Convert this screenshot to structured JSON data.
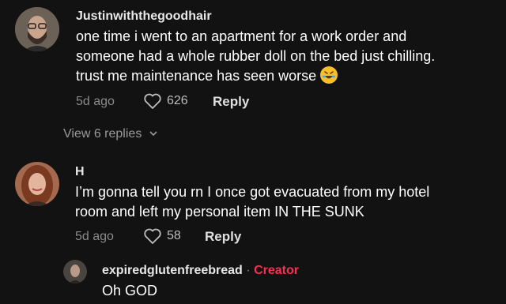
{
  "comments": [
    {
      "username": "Justinwiththegoodhair",
      "text": [
        "one time i went to an apartment for a work order and",
        "someone had a whole rubber doll on the bed just chilling.",
        "trust me maintenance has seen worse"
      ],
      "emoji": "rolling-on-floor-laughing",
      "time": "5d ago",
      "likes": "626",
      "reply_label": "Reply",
      "view_replies": "View 6 replies"
    },
    {
      "username": "H",
      "text": [
        "I’m gonna tell you rn I once got evacuated from my hotel",
        "room and left my personal item IN THE SUNK"
      ],
      "time": "5d ago",
      "likes": "58",
      "reply_label": "Reply"
    }
  ],
  "reply": {
    "username": "expiredglutenfreebread",
    "separator": "·",
    "badge": "Creator",
    "text": "Oh GOD"
  },
  "colors": {
    "background": "#121212",
    "creator": "#fe2c55",
    "muted": "#8a8a8a"
  }
}
